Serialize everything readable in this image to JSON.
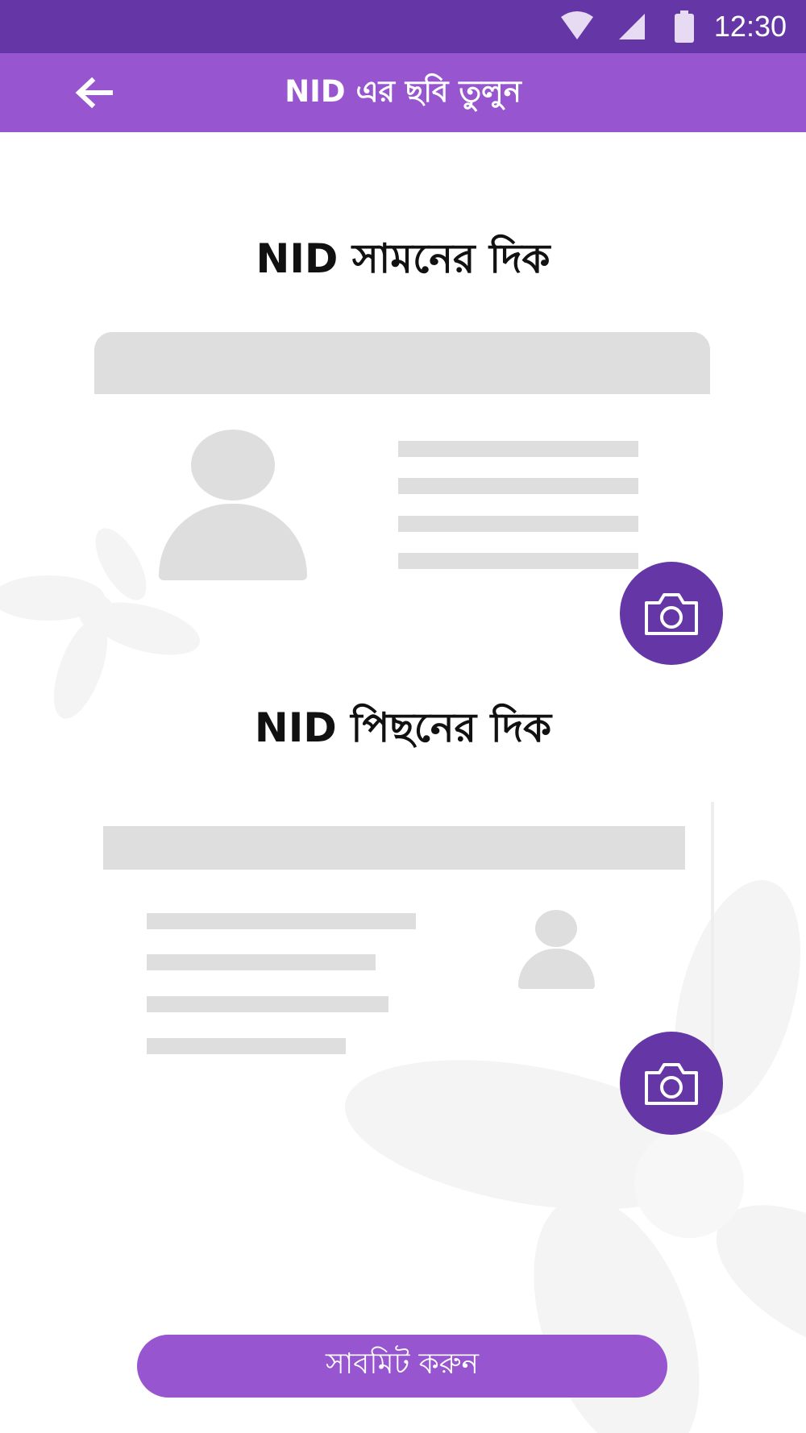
{
  "status_bar": {
    "time": "12:30",
    "icons": [
      "wifi-icon",
      "signal-icon",
      "battery-icon"
    ]
  },
  "app_bar": {
    "title": "NID এর ছবি তুলুন",
    "back_icon": "arrow-left-icon"
  },
  "front_section": {
    "title": "NID সামনের দিক",
    "camera_icon": "camera-icon"
  },
  "back_section": {
    "title": "NID পিছনের দিক",
    "camera_icon": "camera-icon"
  },
  "submit": {
    "label": "সাবমিট করুন"
  },
  "colors": {
    "status_bar": "#6537a6",
    "app_bar": "#9756cf",
    "camera_button": "#6537a6",
    "submit_button": "#9756cf",
    "placeholder": "#dedede"
  }
}
